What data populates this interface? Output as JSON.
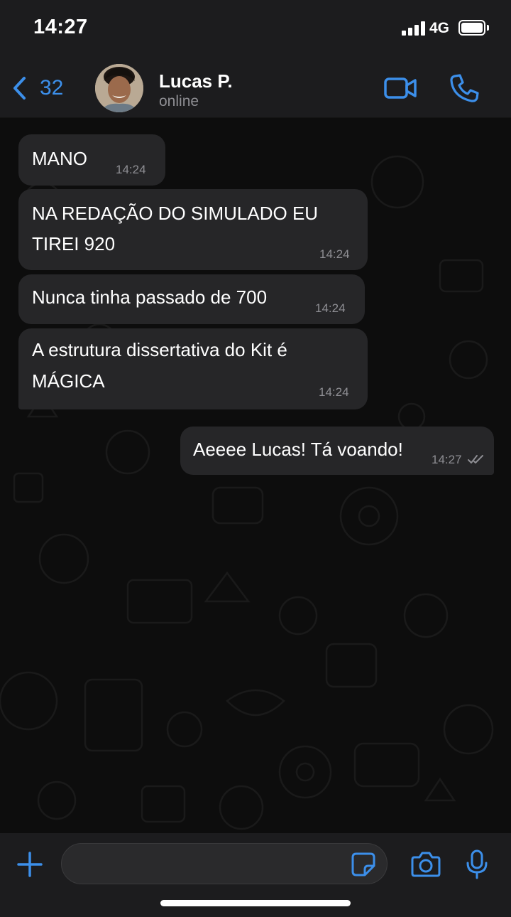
{
  "status_bar": {
    "time": "14:27",
    "network": "4G",
    "signal_icon": "signal-bars-icon",
    "battery_icon": "battery-icon"
  },
  "header": {
    "back_count": "32",
    "contact_name": "Lucas P.",
    "contact_status": "online",
    "back_icon": "chevron-left-icon",
    "video_icon": "video-camera-icon",
    "call_icon": "phone-icon",
    "accent_color": "#3c8fea"
  },
  "messages": [
    {
      "direction": "incoming",
      "text": "MANO",
      "time": "14:24"
    },
    {
      "direction": "incoming",
      "text_lines": [
        "NA REDAÇÃO DO SIMULADO EU",
        "TIREI 920"
      ],
      "time": "14:24"
    },
    {
      "direction": "incoming",
      "text": "Nunca tinha passado de 700",
      "time": "14:24"
    },
    {
      "direction": "incoming",
      "text_lines": [
        "A estrutura dissertativa do Kit é",
        "MÁGICA"
      ],
      "time": "14:24"
    },
    {
      "direction": "outgoing",
      "text": "Aeeee Lucas! Tá voando!",
      "time": "14:27",
      "status_icon": "double-check-icon"
    }
  ],
  "composer": {
    "placeholder": "",
    "plus_icon": "plus-icon",
    "sticker_icon": "sticker-icon",
    "camera_icon": "camera-icon",
    "mic_icon": "microphone-icon"
  }
}
